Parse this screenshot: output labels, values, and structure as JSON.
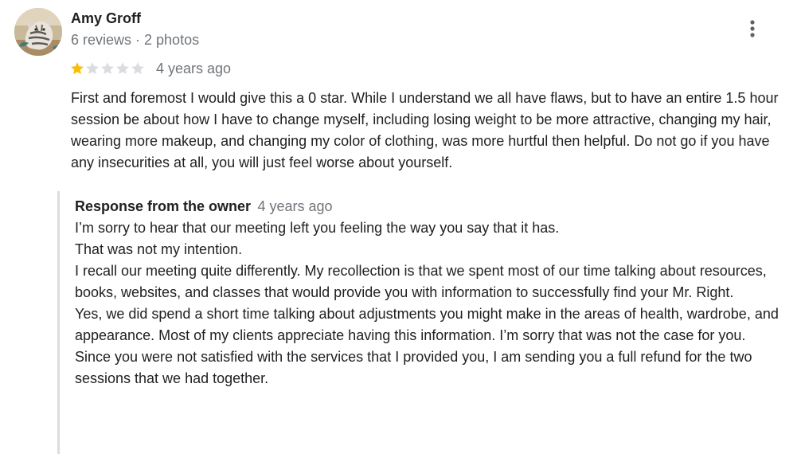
{
  "review": {
    "author": {
      "name": "Amy Groff",
      "meta": "6 reviews · 2 photos"
    },
    "rating": {
      "value": 1,
      "max": 5,
      "filled_color": "#fbbc04",
      "empty_color": "#dadce0"
    },
    "date": "4 years ago",
    "text": "First and foremost I would give this a 0 star. While I understand we all have flaws, but to have an entire 1.5 hour session be about how I have to change myself, including losing weight to be more attractive, changing my hair, wearing more makeup, and changing my color of clothing, was more hurtful then helpful. Do not go if you have any insecurities at all, you will just feel worse about yourself.",
    "more_icon": "more-vert-icon"
  },
  "response": {
    "title": "Response from the owner",
    "date": "4 years ago",
    "paragraphs": [
      "I’m sorry to hear that our meeting left you feeling the way you say that it has.",
      "That was not my intention.",
      "I recall our meeting quite differently. My recollection is that we spent most of our time talking about resources, books, websites, and classes that would provide you with information to successfully find your Mr. Right.",
      "Yes, we did spend a short time talking about adjustments you might make in the areas of health, wardrobe, and appearance. Most of my clients appreciate having this information. I’m sorry that was not the case for you.",
      "Since you were not satisfied with the services that I provided you, I am sending you a full refund for the two sessions that we had together."
    ]
  }
}
